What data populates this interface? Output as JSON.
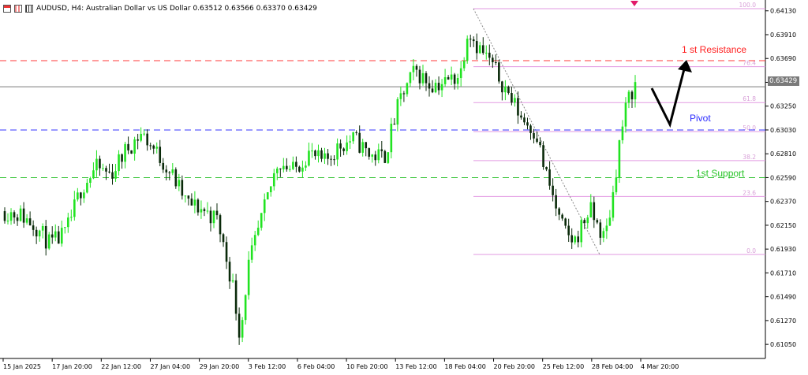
{
  "header": {
    "symbol_line": "AUDUSD, H4:  Australian Dollar vs US Dollar  0.63512 0.63566 0.63370 0.63429",
    "icons": [
      "chart-window-icon",
      "bar-chart-icon",
      "candles-icon"
    ]
  },
  "annotations": {
    "resistance": "1 st Resistance",
    "pivot": "Pivot",
    "support": "1st Support"
  },
  "last_price_label": "0.63429",
  "colors": {
    "bull": "#21e321",
    "bear": "#0a2a0a",
    "resistance": "#ff3838",
    "pivot": "#3434ff",
    "support": "#34c434",
    "fib": "#e29ae2",
    "price_line": "#7a7a7a"
  },
  "chart_data": {
    "type": "candlestick",
    "ylim": [
      0.6092,
      0.6423
    ],
    "y_ticks": [
      "0.64130",
      "0.63910",
      "0.63690",
      "0.63470",
      "0.63250",
      "0.63030",
      "0.62810",
      "0.62590",
      "0.62370",
      "0.62150",
      "0.61930",
      "0.61710",
      "0.61490",
      "0.61270",
      "0.61050"
    ],
    "x_ticks": [
      "15 Jan 2025",
      "17 Jan 20:00",
      "22 Jan 12:00",
      "27 Jan 04:00",
      "29 Jan 20:00",
      "3 Feb 12:00",
      "6 Feb 04:00",
      "10 Feb 20:00",
      "13 Feb 12:00",
      "18 Feb 04:00",
      "20 Feb 20:00",
      "25 Feb 12:00",
      "28 Feb 04:00",
      "4 Mar 20:00"
    ],
    "horizontal_levels": [
      {
        "name": "1 st Resistance",
        "price": 0.6367
      },
      {
        "name": "Pivot",
        "price": 0.6303
      },
      {
        "name": "1st Support",
        "price": 0.6259
      }
    ],
    "last_price": 0.63429,
    "fibonacci": {
      "high": 0.6415,
      "low": 0.6188,
      "levels": [
        "100.0",
        "76.4",
        "61.8",
        "50.0",
        "38.2",
        "23.6",
        "0.0"
      ]
    },
    "close_path": [
      [
        0,
        0.6228
      ],
      [
        0.02,
        0.6225
      ],
      [
        0.04,
        0.6215
      ],
      [
        0.06,
        0.6197
      ],
      [
        0.08,
        0.6207
      ],
      [
        0.1,
        0.6248
      ],
      [
        0.12,
        0.6268
      ],
      [
        0.14,
        0.6262
      ],
      [
        0.16,
        0.6285
      ],
      [
        0.18,
        0.63
      ],
      [
        0.2,
        0.6282
      ],
      [
        0.22,
        0.6262
      ],
      [
        0.24,
        0.6235
      ],
      [
        0.26,
        0.623
      ],
      [
        0.28,
        0.622
      ],
      [
        0.3,
        0.616
      ],
      [
        0.31,
        0.6112
      ],
      [
        0.32,
        0.6175
      ],
      [
        0.34,
        0.6225
      ],
      [
        0.36,
        0.6275
      ],
      [
        0.38,
        0.6265
      ],
      [
        0.4,
        0.6282
      ],
      [
        0.42,
        0.6272
      ],
      [
        0.44,
        0.6288
      ],
      [
        0.46,
        0.6295
      ],
      [
        0.48,
        0.628
      ],
      [
        0.5,
        0.6278
      ],
      [
        0.52,
        0.633
      ],
      [
        0.54,
        0.6358
      ],
      [
        0.56,
        0.6345
      ],
      [
        0.58,
        0.6347
      ],
      [
        0.6,
        0.6355
      ],
      [
        0.61,
        0.6398
      ],
      [
        0.62,
        0.6383
      ],
      [
        0.64,
        0.6365
      ],
      [
        0.66,
        0.634
      ],
      [
        0.68,
        0.6315
      ],
      [
        0.7,
        0.63
      ],
      [
        0.71,
        0.6268
      ],
      [
        0.72,
        0.6245
      ],
      [
        0.73,
        0.622
      ],
      [
        0.74,
        0.6205
      ],
      [
        0.75,
        0.62
      ],
      [
        0.76,
        0.6215
      ],
      [
        0.77,
        0.623
      ],
      [
        0.78,
        0.6215
      ],
      [
        0.79,
        0.6202
      ],
      [
        0.8,
        0.624
      ],
      [
        0.81,
        0.6295
      ],
      [
        0.82,
        0.633
      ],
      [
        0.83,
        0.6345
      ]
    ]
  }
}
